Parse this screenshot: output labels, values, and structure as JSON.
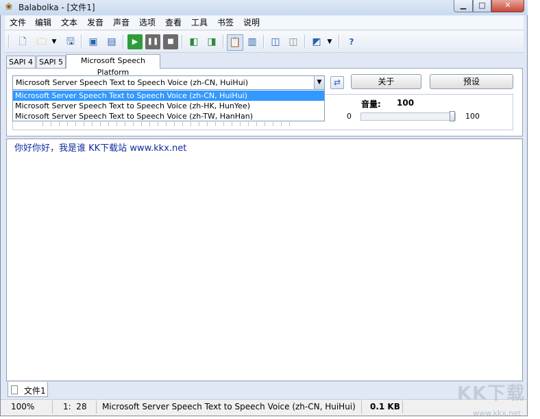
{
  "window": {
    "title": "Balabolka - [文件1]"
  },
  "menu": [
    "文件",
    "编辑",
    "文本",
    "发音",
    "声音",
    "选项",
    "查看",
    "工具",
    "书签",
    "说明"
  ],
  "toolbar": {
    "icons": [
      "new-doc-icon",
      "open-folder-icon",
      "dropdown-arrow-icon",
      "save-icon",
      "export-audio-icon",
      "batch-convert-icon",
      "play-icon",
      "pause-icon",
      "stop-icon",
      "prev-icon",
      "next-icon",
      "clipboard-icon",
      "spell-icon",
      "insert-icon",
      "compare-icon",
      "voice-icon",
      "help-icon"
    ]
  },
  "tabs": [
    "SAPI 4",
    "SAPI 5",
    "Microsoft Speech Platform"
  ],
  "voice": {
    "selected": "Microsoft Server Speech Text to Speech Voice (zh-CN, HuiHui)",
    "options": [
      "Microsoft Server Speech Text to Speech Voice (zh-CN, HuiHui)",
      "Microsoft Server Speech Text to Speech Voice (zh-HK, HunYee)",
      "Microsoft Server Speech Text to Speech Voice (zh-TW, HanHan)"
    ]
  },
  "buttons": {
    "about": "关于",
    "preset": "预设"
  },
  "volume": {
    "label": "音量:",
    "value": "100",
    "min": "0",
    "max": "100",
    "level": 100
  },
  "editor": {
    "text": "你好你好，我是谁 KK下载站 www.kkx.net"
  },
  "document_tab": "文件1",
  "status": {
    "zoom": "100%",
    "position": "1:  28",
    "voice": "Microsoft Server Speech Text to Speech Voice (zh-CN, HuiHui)",
    "size": "0.1 KB"
  },
  "watermark": {
    "logo": "KK下载",
    "url": "www.kkx.net"
  }
}
